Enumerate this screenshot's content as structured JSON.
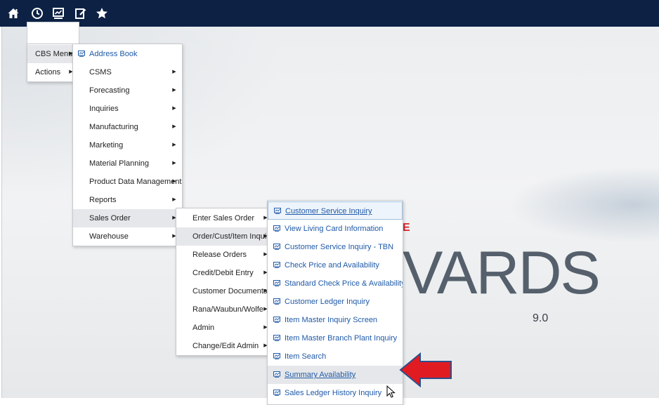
{
  "toolbar": {
    "icons": [
      "home-icon",
      "clock-icon",
      "chart-monitor-icon",
      "edit-icon",
      "star-icon"
    ]
  },
  "background": {
    "brand_fragment": "E",
    "product_name": "VARDS",
    "version": "9.0"
  },
  "menu_root": {
    "items": [
      {
        "label": "CBS Menu"
      },
      {
        "label": "Actions"
      }
    ]
  },
  "menu_cbs": {
    "items": [
      {
        "label": "Address Book"
      },
      {
        "label": "CSMS"
      },
      {
        "label": "Forecasting"
      },
      {
        "label": "Inquiries"
      },
      {
        "label": "Manufacturing"
      },
      {
        "label": "Marketing"
      },
      {
        "label": "Material Planning"
      },
      {
        "label": "Product Data Management"
      },
      {
        "label": "Reports"
      },
      {
        "label": "Sales Order"
      },
      {
        "label": "Warehouse"
      }
    ]
  },
  "menu_sales_order": {
    "items": [
      {
        "label": "Enter Sales Order"
      },
      {
        "label": "Order/Cust/Item Inquiry"
      },
      {
        "label": "Release Orders"
      },
      {
        "label": "Credit/Debit Entry"
      },
      {
        "label": "Customer Documents"
      },
      {
        "label": "Rana/Waubun/Wolfe"
      },
      {
        "label": "Admin"
      },
      {
        "label": "Change/Edit Admin"
      }
    ]
  },
  "menu_inquiry": {
    "items": [
      {
        "label": "Customer Service Inquiry"
      },
      {
        "label": "View Living Card Information"
      },
      {
        "label": "Customer Service Inquiry - TBN"
      },
      {
        "label": "Check Price and Availability"
      },
      {
        "label": "Standard Check Price & Availability"
      },
      {
        "label": "Customer Ledger Inquiry"
      },
      {
        "label": "Item Master Inquiry Screen"
      },
      {
        "label": "Item Master Branch Plant Inquiry"
      },
      {
        "label": "Item Search"
      },
      {
        "label": "Summary Availability"
      },
      {
        "label": "Sales Ledger History Inquiry"
      }
    ]
  },
  "colors": {
    "topbar": "#0c2144",
    "link": "#1f5aa8",
    "annotation_arrow": "#e11b22"
  }
}
